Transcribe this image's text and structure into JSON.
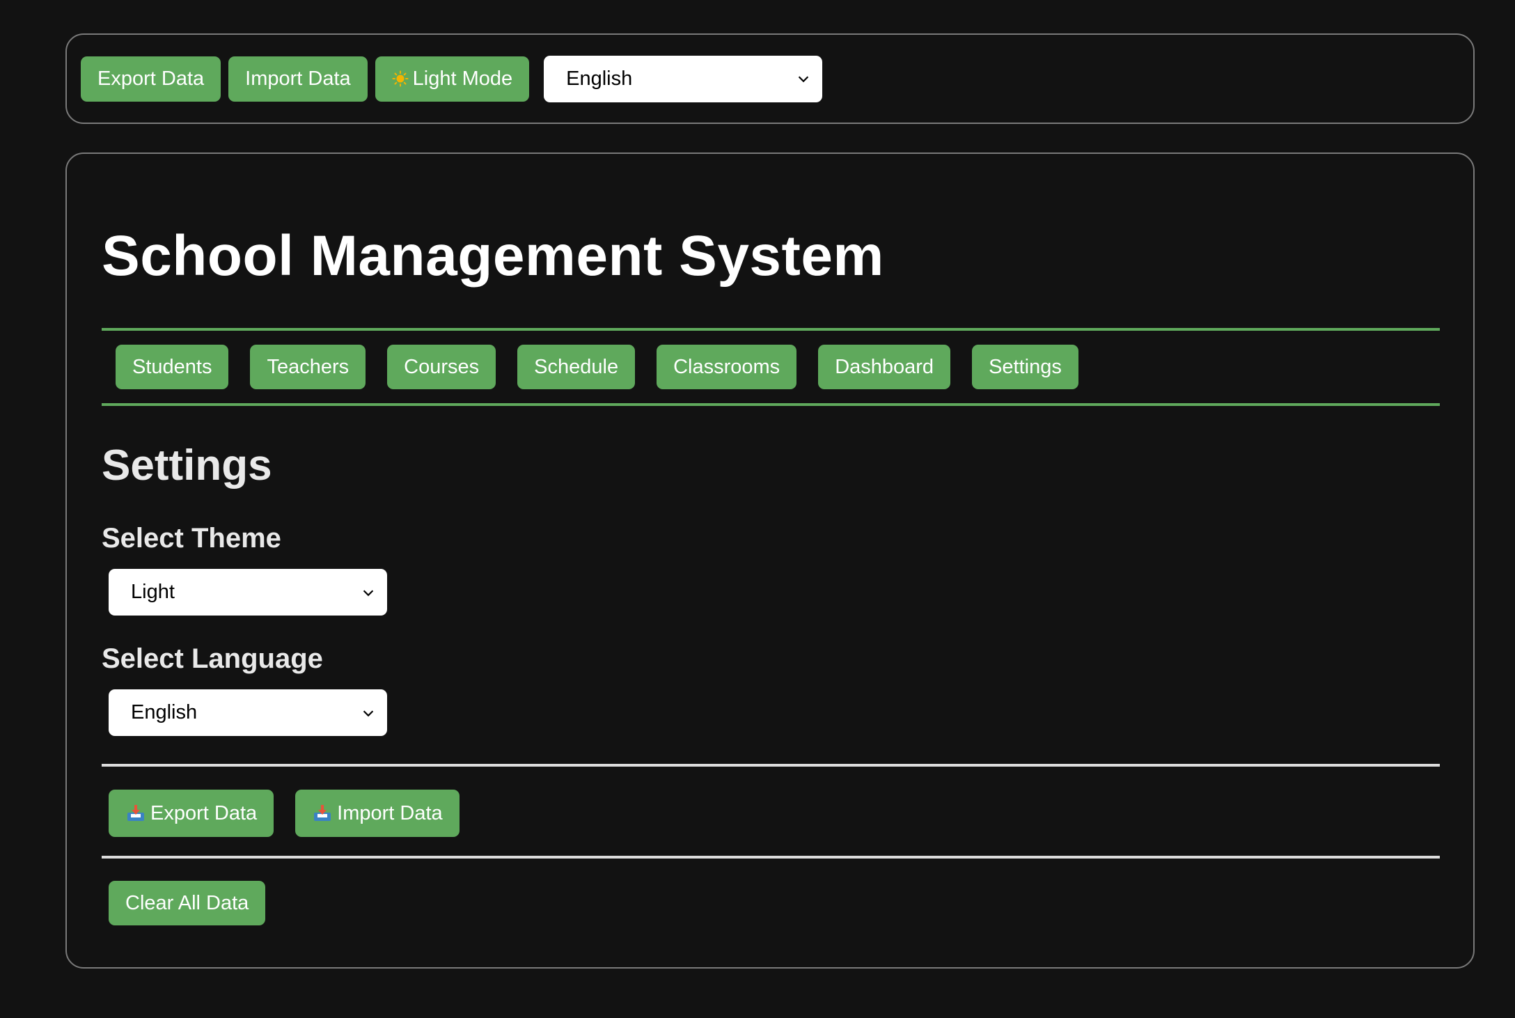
{
  "topbar": {
    "export_label": "Export Data",
    "import_label": "Import Data",
    "mode_label": "Light Mode",
    "language_value": "English"
  },
  "app": {
    "title": "School Management System"
  },
  "nav": {
    "items": [
      {
        "label": "Students"
      },
      {
        "label": "Teachers"
      },
      {
        "label": "Courses"
      },
      {
        "label": "Schedule"
      },
      {
        "label": "Classrooms"
      },
      {
        "label": "Dashboard"
      },
      {
        "label": "Settings"
      }
    ]
  },
  "settings": {
    "title": "Settings",
    "theme_label": "Select Theme",
    "theme_value": "Light",
    "language_label": "Select Language",
    "language_value": "English",
    "export_label": "Export Data",
    "import_label": "Import Data",
    "clear_label": "Clear All Data"
  },
  "colors": {
    "accent": "#5fa95c",
    "background": "#121212",
    "border": "#7a7a7a"
  },
  "icons": {
    "mode": "sun-icon",
    "export": "inbox-tray-icon",
    "import": "inbox-tray-icon",
    "select": "chevron-down-icon"
  }
}
